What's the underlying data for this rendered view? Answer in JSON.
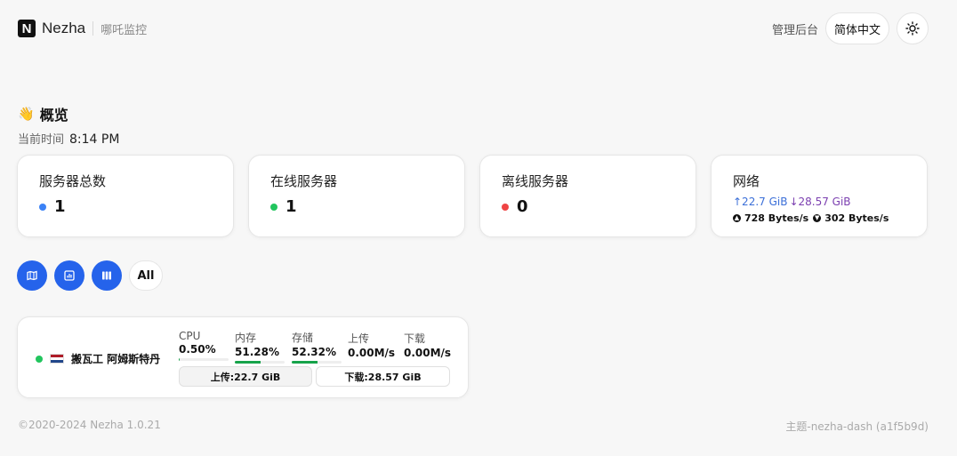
{
  "header": {
    "logo_letter": "N",
    "brand_name": "Nezha",
    "brand_subtitle": "哪吒监控",
    "admin_link": "管理后台",
    "language": "简体中文",
    "theme_icon": "sun-icon"
  },
  "overview": {
    "emoji": "👋",
    "title": "概览",
    "time_label": "当前时间",
    "time_value": "8:14 PM"
  },
  "stats": {
    "total": {
      "label": "服务器总数",
      "value": "1",
      "dot_color": "#3b82f6"
    },
    "online": {
      "label": "在线服务器",
      "value": "1",
      "dot_color": "#22c55e"
    },
    "offline": {
      "label": "离线服务器",
      "value": "0",
      "dot_color": "#ef4444"
    },
    "network": {
      "label": "网络",
      "upload_total": "↑22.7 GiB",
      "download_total": "↓28.57 GiB",
      "upload_speed": "728 Bytes/s",
      "download_speed": "302 Bytes/s"
    }
  },
  "views": {
    "icons": [
      "map-icon",
      "chart-icon",
      "grid-icon"
    ],
    "filter_all": "All",
    "accent": "#2563eb"
  },
  "server": {
    "status_color": "#22c55e",
    "flag": "netherlands-flag-icon",
    "name": "搬瓦工 阿姆斯特丹",
    "cpu_label": "CPU",
    "cpu_value": "0.50%",
    "cpu_pct": 0.5,
    "mem_label": "内存",
    "mem_value": "51.28%",
    "mem_pct": 51.28,
    "disk_label": "存储",
    "disk_value": "52.32%",
    "disk_pct": 52.32,
    "up_label": "上传",
    "up_value": "0.00M/s",
    "down_label": "下载",
    "down_value": "0.00M/s",
    "traffic_up": "上传:22.7 GiB",
    "traffic_down": "下载:28.57 GiB"
  },
  "footer": {
    "copyright": "©2020-2024 Nezha 1.0.21",
    "theme": "主题-nezha-dash (a1f5b9d)"
  }
}
